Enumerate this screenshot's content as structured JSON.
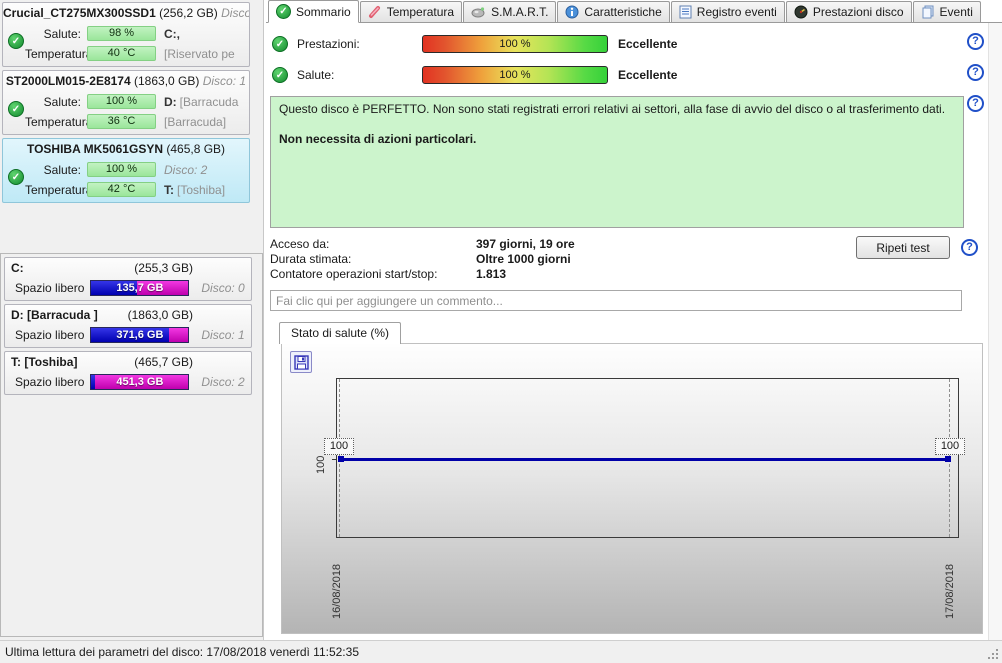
{
  "sidebar": {
    "disks": [
      {
        "title": "Crucial_CT275MX300SSD1",
        "size": "(256,2 GB)",
        "disco": "Disco:",
        "salute_label": "Salute:",
        "salute": "98 %",
        "salute_right_bold": "C:,",
        "salute_right_gray": "",
        "temp_label": "Temperatura:",
        "temp": "40 °C",
        "temp_right_bold": "",
        "temp_right_gray": "[Riservato pe"
      },
      {
        "title": "ST2000LM015-2E8174",
        "size": "(1863,0 GB)",
        "disco": "Disco: 1",
        "salute_label": "Salute:",
        "salute": "100 %",
        "salute_right_bold": "D:",
        "salute_right_gray": "[Barracuda",
        "temp_label": "Temperatura:",
        "temp": "36 °C",
        "temp_right_bold": "",
        "temp_right_gray": "[Barracuda]"
      },
      {
        "title": "TOSHIBA MK5061GSYN",
        "size": "(465,8 GB)",
        "disco": "",
        "salute_label": "Salute:",
        "salute": "100 %",
        "salute_right_italic": "Disco: 2",
        "temp_label": "Temperatura:",
        "temp": "42 °C",
        "temp_right_bold": "T:",
        "temp_right_gray": "[Toshiba]"
      }
    ],
    "partitions": [
      {
        "name": "C:",
        "size": "(255,3 GB)",
        "free_label": "Spazio libero",
        "free": "135,7 GB",
        "disk": "Disco: 0",
        "used_pct": 47
      },
      {
        "name": "D: [Barracuda ]",
        "size": "(1863,0 GB)",
        "free_label": "Spazio libero",
        "free": "371,6 GB",
        "disk": "Disco: 1",
        "used_pct": 80
      },
      {
        "name": "T: [Toshiba]",
        "size": "(465,7 GB)",
        "free_label": "Spazio libero",
        "free": "451,3 GB",
        "disk": "Disco: 2",
        "used_pct": 4
      }
    ]
  },
  "tabs": [
    {
      "label": "Sommario",
      "icon": "check-circle-icon",
      "active": true
    },
    {
      "label": "Temperatura",
      "icon": "thermometer-icon",
      "active": false
    },
    {
      "label": "S.M.A.R.T.",
      "icon": "smart-icon",
      "active": false
    },
    {
      "label": "Caratteristiche",
      "icon": "info-icon",
      "active": false
    },
    {
      "label": "Registro eventi",
      "icon": "document-icon",
      "active": false
    },
    {
      "label": "Prestazioni disco",
      "icon": "gauge-icon",
      "active": false
    },
    {
      "label": "Eventi",
      "icon": "pages-icon",
      "active": false
    }
  ],
  "summary": {
    "performance_label": "Prestazioni:",
    "performance_value": "100 %",
    "performance_rating": "Eccellente",
    "health_label": "Salute:",
    "health_value": "100 %",
    "health_rating": "Eccellente",
    "message_line1": "Questo disco è PERFETTO. Non sono stati registrati errori relativi ai settori, alla fase di avvio del disco o al trasferimento dati.",
    "message_line2": "Non necessita di azioni particolari.",
    "info": [
      {
        "label": "Acceso da:",
        "value": "397 giorni, 19 ore"
      },
      {
        "label": "Durata stimata:",
        "value": "Oltre 1000 giorni"
      },
      {
        "label": "Contatore operazioni start/stop:",
        "value": "1.813"
      }
    ],
    "retest_button": "Ripeti test",
    "comment_placeholder": "Fai clic qui per aggiungere un commento...",
    "help_icon_glyph": "?"
  },
  "chart": {
    "tab_label": "Stato di salute (%)"
  },
  "chart_data": {
    "type": "line",
    "title": "Stato di salute (%)",
    "x": [
      "16/08/2018",
      "17/08/2018"
    ],
    "series": [
      {
        "name": "Stato di salute (%)",
        "values": [
          100,
          100
        ]
      }
    ],
    "point_labels": [
      "100",
      "100"
    ],
    "y_tick_labels": [
      "100"
    ],
    "line_color": "#0000a8",
    "grid": "dashed vertical at data points",
    "legend": "none"
  },
  "colors": {
    "health_bar_green": "#a9eba9",
    "free_space_magenta": "#d400c4",
    "used_space_blue": "#0f0fc0",
    "selected_panel_cyan": "#cdeef8",
    "message_bg_green": "#ccf4cc",
    "help_blue": "#2050c8"
  },
  "statusbar": {
    "text": "Ultima lettura dei parametri del disco: 17/08/2018 venerdì 11:52:35"
  }
}
